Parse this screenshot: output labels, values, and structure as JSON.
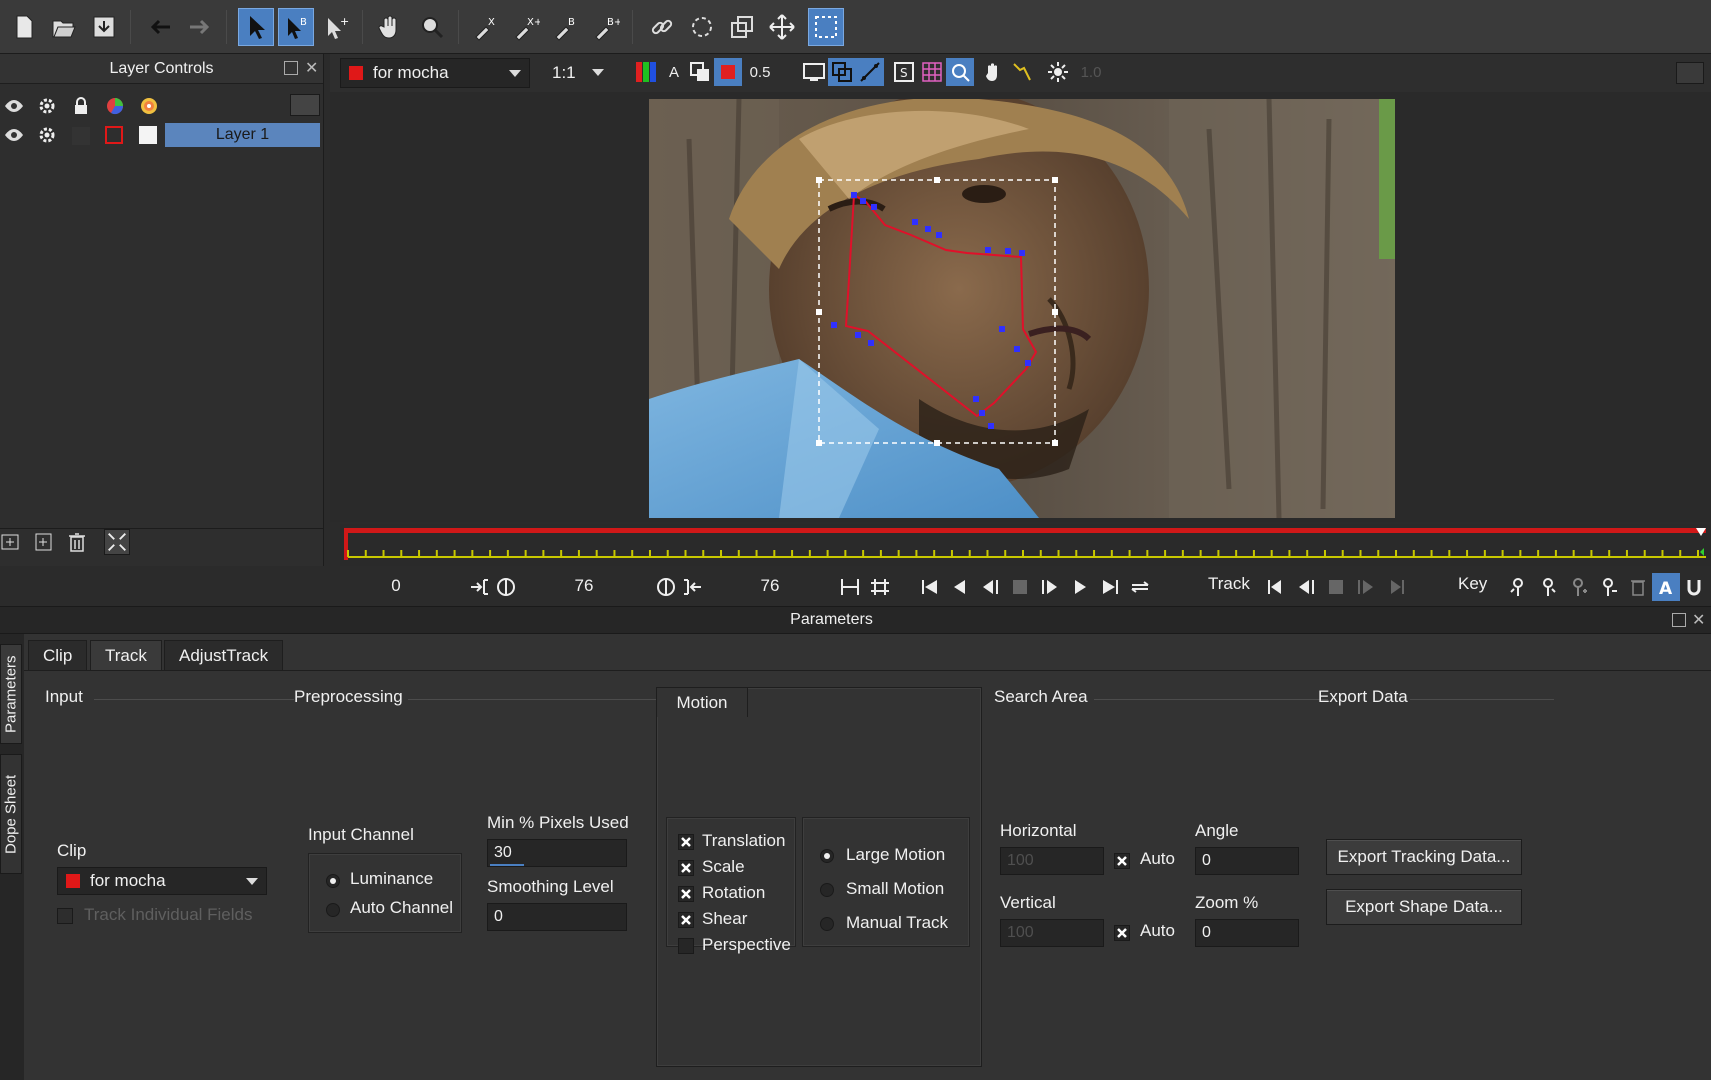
{
  "toolbar": {
    "icons": [
      "new-file-icon",
      "open-file-icon",
      "save-icon",
      "undo-icon",
      "redo-icon",
      "select-icon",
      "select-bezier-icon",
      "add-point-icon",
      "pan-icon",
      "zoom-icon",
      "xspline-pen-icon",
      "xspline-add-icon",
      "bezier-pen-icon",
      "bezier-add-icon",
      "link-icon",
      "lasso-icon",
      "transform-icon",
      "move-icon",
      "marquee-icon"
    ]
  },
  "layers": {
    "title": "Layer Controls",
    "layer1_name": "Layer 1"
  },
  "viewer": {
    "clip": "for mocha",
    "zoom": "1:1",
    "opacity": "0.5",
    "exposure": "1.0"
  },
  "transport": {
    "in_frame": "0",
    "current_frame": "76",
    "out_frame": "76",
    "track_label": "Track",
    "key_label": "Key"
  },
  "params": {
    "title": "Parameters",
    "side_tabs": [
      "Parameters",
      "Dope Sheet"
    ],
    "tabs": [
      "Clip",
      "Track",
      "AdjustTrack"
    ],
    "sections": {
      "input": "Input",
      "preprocessing": "Preprocessing",
      "motion": "Motion",
      "search_area": "Search Area",
      "export_data": "Export Data"
    },
    "clip_label": "Clip",
    "clip_value": "for mocha",
    "track_individual_fields": "Track Individual Fields",
    "input_channel": "Input Channel",
    "luminance": "Luminance",
    "auto_channel": "Auto Channel",
    "min_pixels_label": "Min % Pixels Used",
    "min_pixels_value": "30",
    "smoothing_label": "Smoothing Level",
    "smoothing_value": "0",
    "motion_types": [
      {
        "label": "Translation",
        "checked": true
      },
      {
        "label": "Scale",
        "checked": true
      },
      {
        "label": "Rotation",
        "checked": true
      },
      {
        "label": "Shear",
        "checked": true
      },
      {
        "label": "Perspective",
        "checked": false
      }
    ],
    "motion_modes": [
      {
        "label": "Large Motion",
        "selected": true
      },
      {
        "label": "Small Motion",
        "selected": false
      },
      {
        "label": "Manual Track",
        "selected": false
      }
    ],
    "horizontal_label": "Horizontal",
    "horizontal_value": "100",
    "vertical_label": "Vertical",
    "vertical_value": "100",
    "auto_label": "Auto",
    "angle_label": "Angle",
    "angle_value": "0",
    "zoom_label": "Zoom %",
    "zoom_value": "0",
    "export_tracking": "Export Tracking Data...",
    "export_shape": "Export Shape Data..."
  },
  "colors": {
    "accent": "#4a7fc1",
    "layer_selected": "#5b85bd",
    "timeline_red": "#d01818",
    "spline": "#e0102a",
    "spline_point": "#3030ff"
  }
}
